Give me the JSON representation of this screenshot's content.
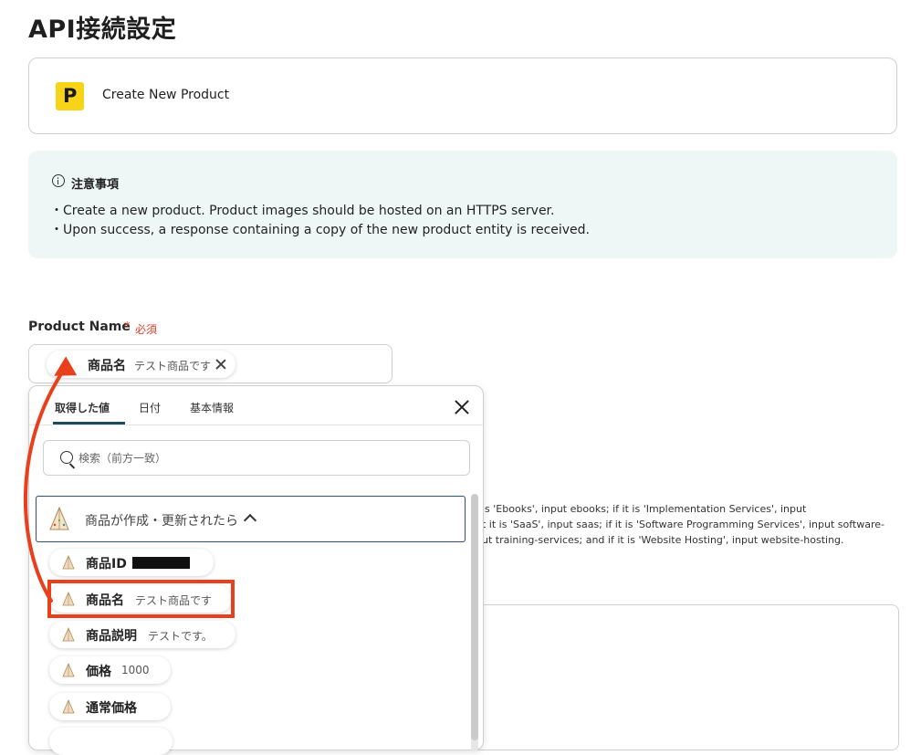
{
  "page": {
    "title": "API接続設定"
  },
  "app_card": {
    "logo_letter": "P",
    "action_name": "Create New Product"
  },
  "notice": {
    "title": "注意事項",
    "lines": [
      "・Create a new product. Product images should be hosted on an HTTPS server.",
      "・Upon success, a response containing a copy of the new product entity is received."
    ]
  },
  "product_name_field": {
    "label": "Product Name",
    "required_mark": "*",
    "required_text": "必須",
    "chip": {
      "label": "商品名",
      "value": "テスト商品です"
    }
  },
  "background_help_text": [
    "is 'Ebooks', input ebooks; if it is 'Implementation Services', input",
    "t it is 'SaaS', input saas; if it is 'Software Programming Services', input software-",
    "ut training-services; and if it is 'Website Hosting', input website-hosting."
  ],
  "picker": {
    "tabs": [
      {
        "label": "取得した値",
        "active": true
      },
      {
        "label": "日付",
        "active": false
      },
      {
        "label": "基本情報",
        "active": false
      }
    ],
    "search_placeholder": "検索（前方一致）",
    "group": {
      "label": "商品が作成・更新されたら",
      "expanded": true
    },
    "items": [
      {
        "label": "商品ID",
        "value": "",
        "redacted": true
      },
      {
        "label": "商品名",
        "value": "テスト商品です",
        "highlighted": true
      },
      {
        "label": "商品説明",
        "value": "テストです。"
      },
      {
        "label": "価格",
        "value": "1000"
      },
      {
        "label": "通常価格",
        "value": ""
      }
    ]
  },
  "colors": {
    "accent": "#1e4a60",
    "highlight": "#e8401c",
    "required": "#e0422d",
    "logo": "#f7d417",
    "notice_bg": "#eef7f6"
  },
  "icons": {
    "app_logo": "app-logo-icon",
    "notice": "info-icon",
    "chip": "teepee-icon",
    "close": "close-icon",
    "search": "search-icon",
    "group_toggle": "chevron-up-icon"
  }
}
